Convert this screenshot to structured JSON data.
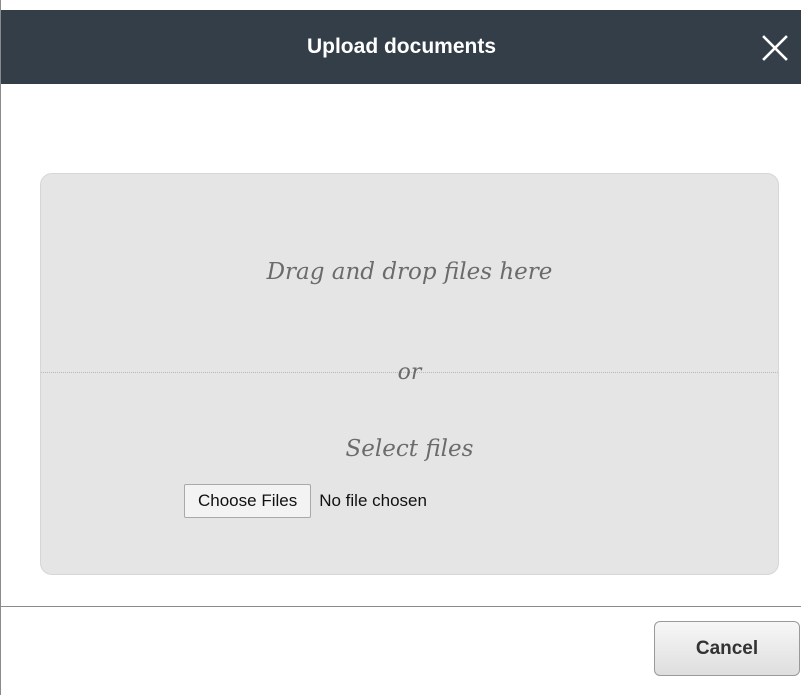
{
  "dialog": {
    "title": "Upload documents",
    "close_icon": "close-icon"
  },
  "dropzone": {
    "drag_text": "Drag and drop files here",
    "or_text": "or",
    "select_text": "Select files",
    "choose_button_label": "Choose Files",
    "file_status": "No file chosen"
  },
  "footer": {
    "cancel_label": "Cancel"
  },
  "colors": {
    "header_bg": "#333e48",
    "dropzone_bg": "#e5e5e5",
    "italic_text": "#6b6b6b"
  }
}
